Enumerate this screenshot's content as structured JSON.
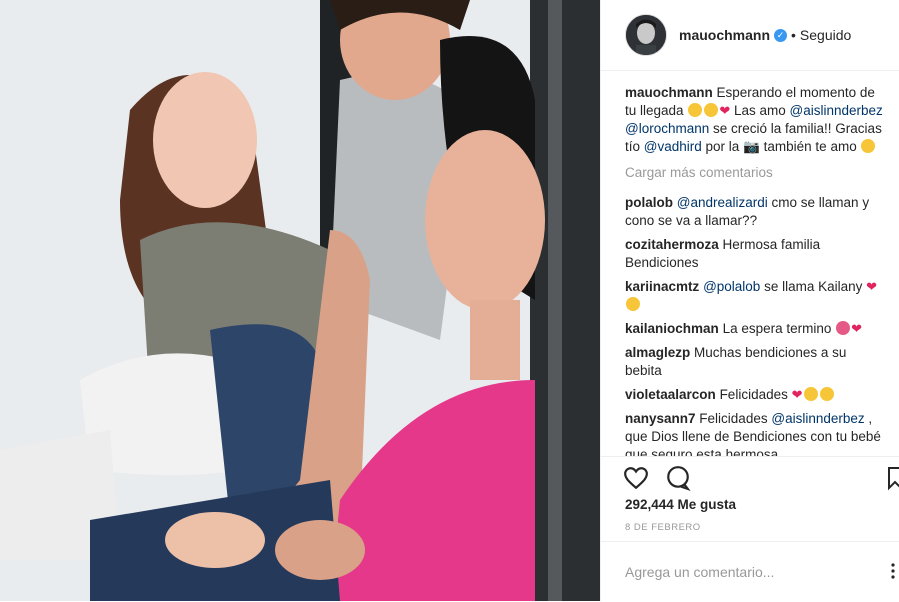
{
  "header": {
    "username": "mauochmann",
    "following": "Seguido",
    "separator": "•"
  },
  "caption": {
    "username": "mauochmann",
    "text1": "Esperando el momento de tu llegada",
    "text2": "Las amo",
    "mention1": "@aislinnderbez",
    "mention2": "@lorochmann",
    "text3": "se creció la familia!! Gracias tío",
    "mention3": "@vadhird",
    "text4": "por la",
    "text5": "también te amo"
  },
  "load_more": "Cargar más comentarios",
  "comments": [
    {
      "user": "polalob",
      "mention": "@andrealizardi",
      "text": "cmo se llaman y cono se va a llamar??"
    },
    {
      "user": "cozitahermoza",
      "text": "Hermosa familia Bendiciones"
    },
    {
      "user": "kariinacmtz",
      "mention": "@polalob",
      "text": "se llama Kailany"
    },
    {
      "user": "kailaniochman",
      "text": "La espera termino"
    },
    {
      "user": "almaglezp",
      "text": "Muchas bendiciones a su bebita"
    },
    {
      "user": "violetaalarcon",
      "text": "Felicidades"
    },
    {
      "user": "nanysann7",
      "text_pre": "Felicidades",
      "mention": "@aislinnderbez",
      "text": ", que Dios llene de Bendiciones con tu bebé que seguro esta hermosa"
    }
  ],
  "likes": "292,444 Me gusta",
  "date": "8 DE FEBRERO",
  "add_comment_placeholder": "Agrega un comentario...",
  "icons": [
    "heart-icon",
    "comment-icon",
    "bookmark-icon",
    "verified-icon"
  ],
  "colors": {
    "link": "#003569",
    "muted": "#999999",
    "verified": "#3897f0",
    "photo_shirt_pink": "#e5388a"
  }
}
